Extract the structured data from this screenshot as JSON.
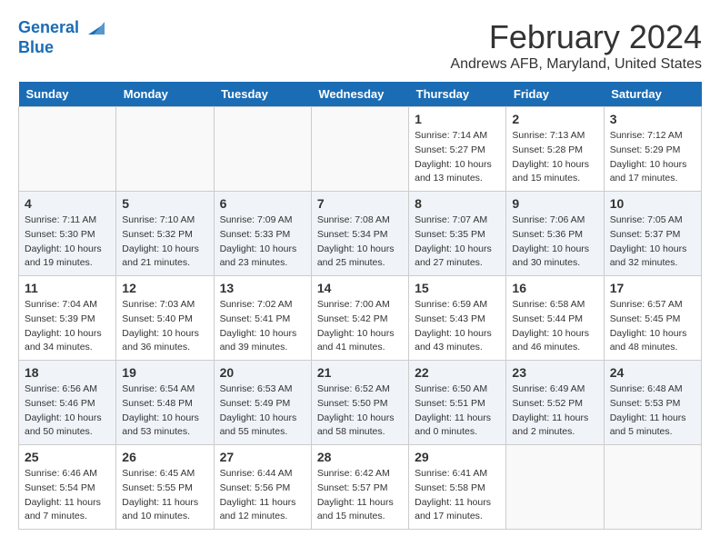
{
  "header": {
    "logo_line1": "General",
    "logo_line2": "Blue",
    "month_title": "February 2024",
    "location": "Andrews AFB, Maryland, United States"
  },
  "days_of_week": [
    "Sunday",
    "Monday",
    "Tuesday",
    "Wednesday",
    "Thursday",
    "Friday",
    "Saturday"
  ],
  "weeks": [
    [
      {
        "day": "",
        "info": ""
      },
      {
        "day": "",
        "info": ""
      },
      {
        "day": "",
        "info": ""
      },
      {
        "day": "",
        "info": ""
      },
      {
        "day": "1",
        "info": "Sunrise: 7:14 AM\nSunset: 5:27 PM\nDaylight: 10 hours\nand 13 minutes."
      },
      {
        "day": "2",
        "info": "Sunrise: 7:13 AM\nSunset: 5:28 PM\nDaylight: 10 hours\nand 15 minutes."
      },
      {
        "day": "3",
        "info": "Sunrise: 7:12 AM\nSunset: 5:29 PM\nDaylight: 10 hours\nand 17 minutes."
      }
    ],
    [
      {
        "day": "4",
        "info": "Sunrise: 7:11 AM\nSunset: 5:30 PM\nDaylight: 10 hours\nand 19 minutes."
      },
      {
        "day": "5",
        "info": "Sunrise: 7:10 AM\nSunset: 5:32 PM\nDaylight: 10 hours\nand 21 minutes."
      },
      {
        "day": "6",
        "info": "Sunrise: 7:09 AM\nSunset: 5:33 PM\nDaylight: 10 hours\nand 23 minutes."
      },
      {
        "day": "7",
        "info": "Sunrise: 7:08 AM\nSunset: 5:34 PM\nDaylight: 10 hours\nand 25 minutes."
      },
      {
        "day": "8",
        "info": "Sunrise: 7:07 AM\nSunset: 5:35 PM\nDaylight: 10 hours\nand 27 minutes."
      },
      {
        "day": "9",
        "info": "Sunrise: 7:06 AM\nSunset: 5:36 PM\nDaylight: 10 hours\nand 30 minutes."
      },
      {
        "day": "10",
        "info": "Sunrise: 7:05 AM\nSunset: 5:37 PM\nDaylight: 10 hours\nand 32 minutes."
      }
    ],
    [
      {
        "day": "11",
        "info": "Sunrise: 7:04 AM\nSunset: 5:39 PM\nDaylight: 10 hours\nand 34 minutes."
      },
      {
        "day": "12",
        "info": "Sunrise: 7:03 AM\nSunset: 5:40 PM\nDaylight: 10 hours\nand 36 minutes."
      },
      {
        "day": "13",
        "info": "Sunrise: 7:02 AM\nSunset: 5:41 PM\nDaylight: 10 hours\nand 39 minutes."
      },
      {
        "day": "14",
        "info": "Sunrise: 7:00 AM\nSunset: 5:42 PM\nDaylight: 10 hours\nand 41 minutes."
      },
      {
        "day": "15",
        "info": "Sunrise: 6:59 AM\nSunset: 5:43 PM\nDaylight: 10 hours\nand 43 minutes."
      },
      {
        "day": "16",
        "info": "Sunrise: 6:58 AM\nSunset: 5:44 PM\nDaylight: 10 hours\nand 46 minutes."
      },
      {
        "day": "17",
        "info": "Sunrise: 6:57 AM\nSunset: 5:45 PM\nDaylight: 10 hours\nand 48 minutes."
      }
    ],
    [
      {
        "day": "18",
        "info": "Sunrise: 6:56 AM\nSunset: 5:46 PM\nDaylight: 10 hours\nand 50 minutes."
      },
      {
        "day": "19",
        "info": "Sunrise: 6:54 AM\nSunset: 5:48 PM\nDaylight: 10 hours\nand 53 minutes."
      },
      {
        "day": "20",
        "info": "Sunrise: 6:53 AM\nSunset: 5:49 PM\nDaylight: 10 hours\nand 55 minutes."
      },
      {
        "day": "21",
        "info": "Sunrise: 6:52 AM\nSunset: 5:50 PM\nDaylight: 10 hours\nand 58 minutes."
      },
      {
        "day": "22",
        "info": "Sunrise: 6:50 AM\nSunset: 5:51 PM\nDaylight: 11 hours\nand 0 minutes."
      },
      {
        "day": "23",
        "info": "Sunrise: 6:49 AM\nSunset: 5:52 PM\nDaylight: 11 hours\nand 2 minutes."
      },
      {
        "day": "24",
        "info": "Sunrise: 6:48 AM\nSunset: 5:53 PM\nDaylight: 11 hours\nand 5 minutes."
      }
    ],
    [
      {
        "day": "25",
        "info": "Sunrise: 6:46 AM\nSunset: 5:54 PM\nDaylight: 11 hours\nand 7 minutes."
      },
      {
        "day": "26",
        "info": "Sunrise: 6:45 AM\nSunset: 5:55 PM\nDaylight: 11 hours\nand 10 minutes."
      },
      {
        "day": "27",
        "info": "Sunrise: 6:44 AM\nSunset: 5:56 PM\nDaylight: 11 hours\nand 12 minutes."
      },
      {
        "day": "28",
        "info": "Sunrise: 6:42 AM\nSunset: 5:57 PM\nDaylight: 11 hours\nand 15 minutes."
      },
      {
        "day": "29",
        "info": "Sunrise: 6:41 AM\nSunset: 5:58 PM\nDaylight: 11 hours\nand 17 minutes."
      },
      {
        "day": "",
        "info": ""
      },
      {
        "day": "",
        "info": ""
      }
    ]
  ]
}
